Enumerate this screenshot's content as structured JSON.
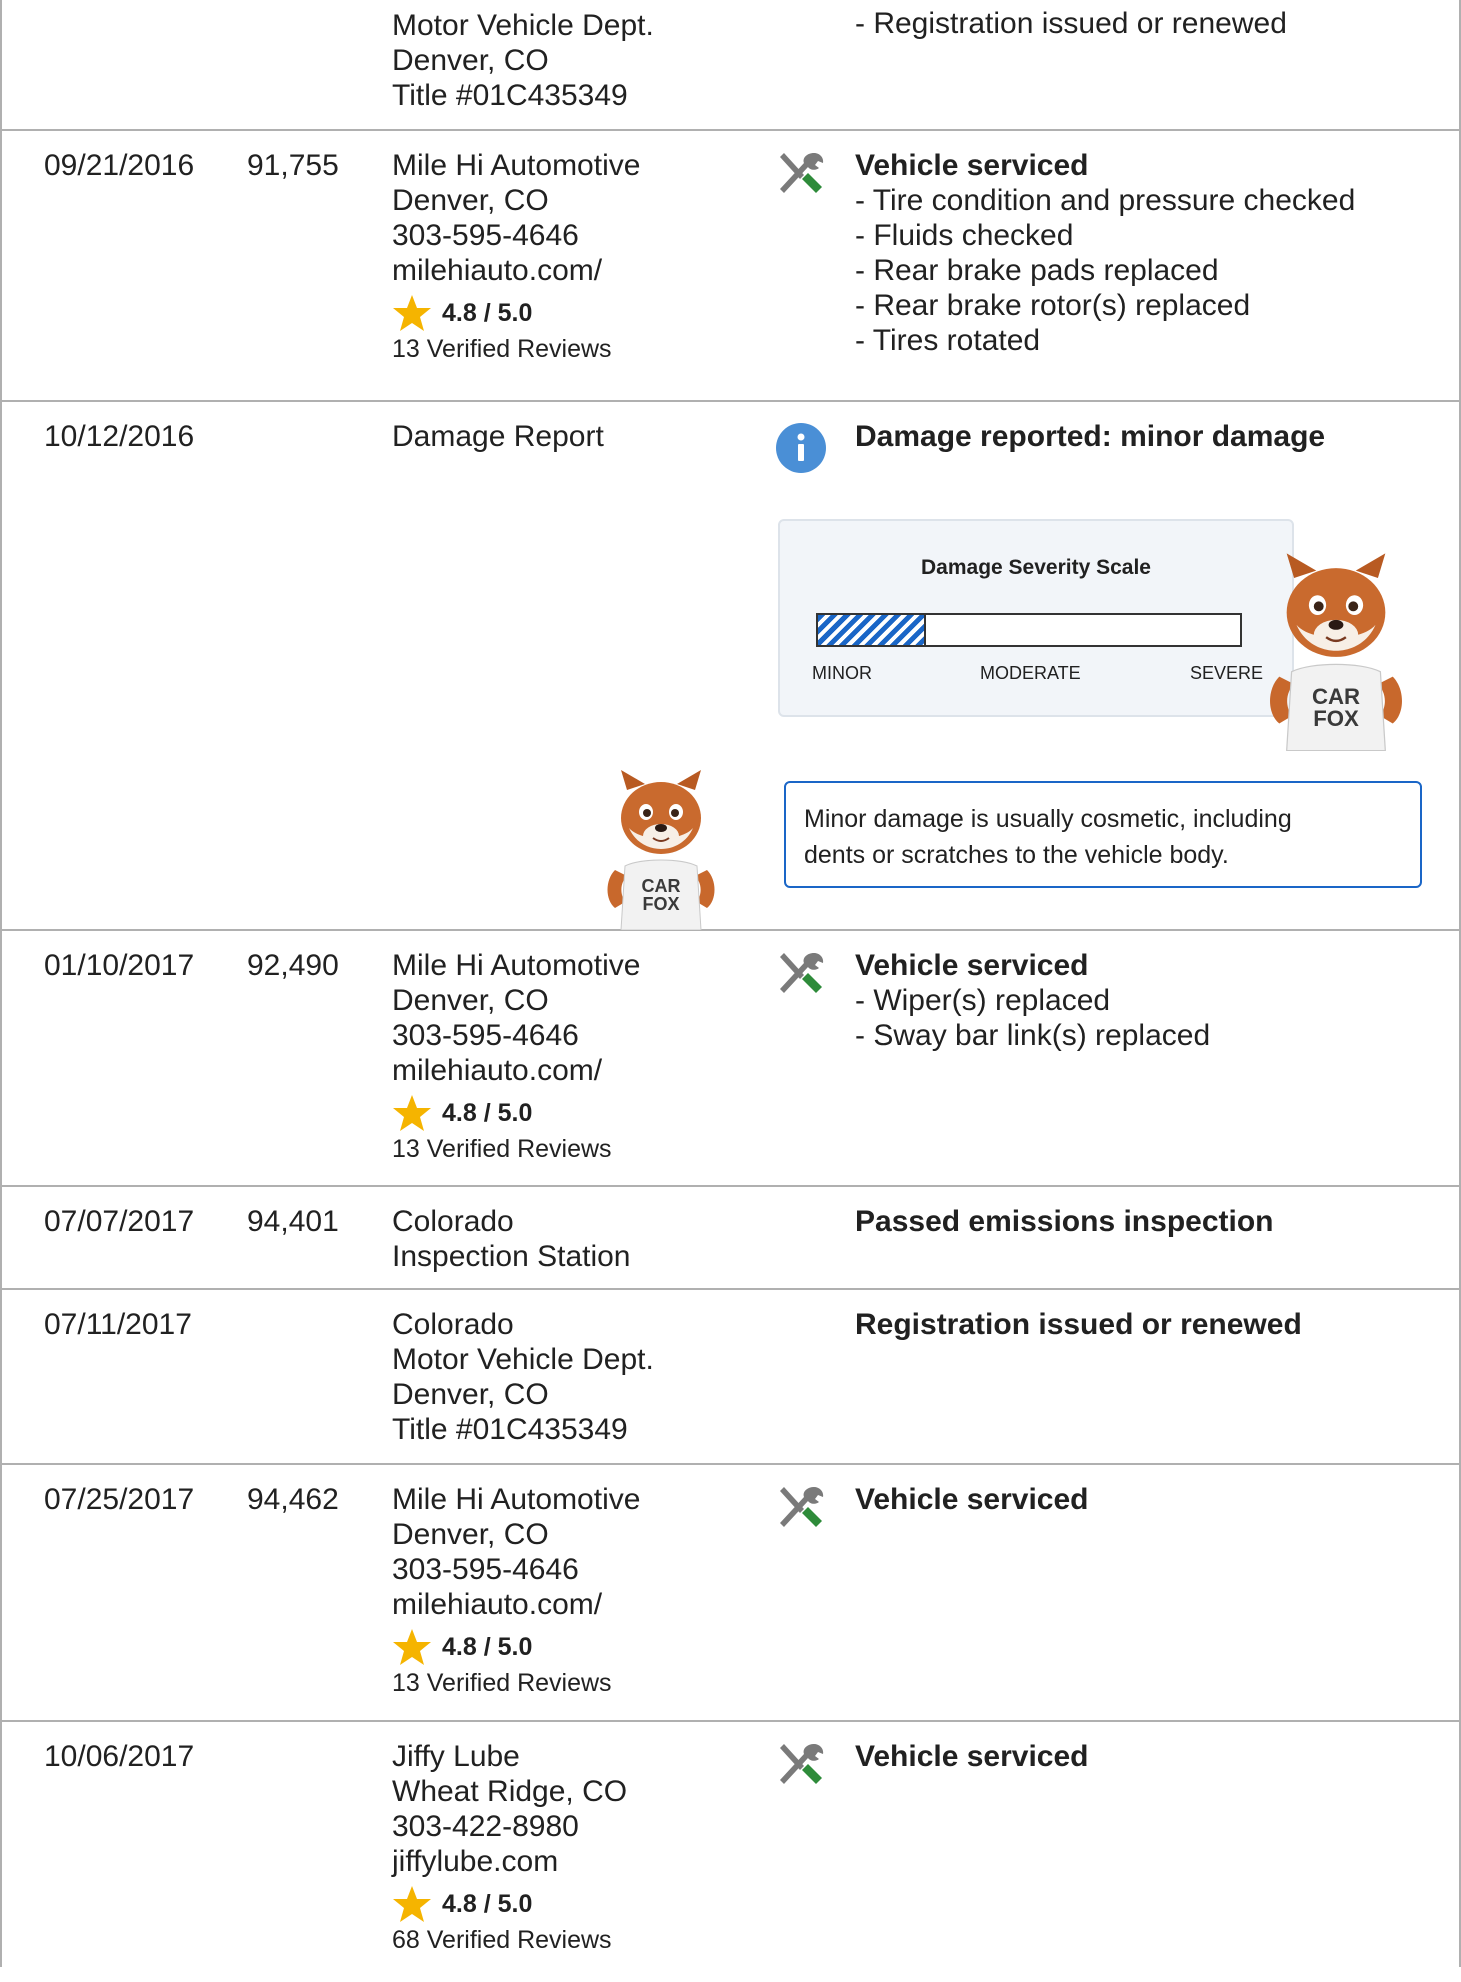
{
  "rows": [
    {
      "date": "",
      "odometer": "",
      "source": [
        "Motor Vehicle Dept.",
        "Denver, CO",
        "Title #01C435349"
      ],
      "details_title": "",
      "details_bullets": [
        "Registration issued or renewed"
      ]
    },
    {
      "date": "09/21/2016",
      "odometer": "91,755",
      "source": [
        "Mile Hi Automotive",
        "Denver, CO",
        "303-595-4646",
        "milehiauto.com/"
      ],
      "rating": "4.8 / 5.0",
      "reviews": "13 Verified Reviews",
      "icon": "wrench-screwdriver-icon",
      "details_title": "Vehicle serviced",
      "details_bullets": [
        "Tire condition and pressure checked",
        "Fluids checked",
        "Rear brake pads replaced",
        "Rear brake rotor(s) replaced",
        "Tires rotated"
      ]
    },
    {
      "date": "10/12/2016",
      "odometer": "",
      "source": [
        "Damage Report"
      ],
      "icon": "info-icon",
      "details_title": "Damage reported: minor damage",
      "severity": {
        "title": "Damage Severity Scale",
        "level": 0.25,
        "labels": [
          "MINOR",
          "MODERATE",
          "SEVERE"
        ]
      },
      "callout": [
        "Minor damage is usually cosmetic, including",
        "dents or scratches to the vehicle body."
      ],
      "mascot_text": [
        "CAR",
        "FOX"
      ]
    },
    {
      "date": "01/10/2017",
      "odometer": "92,490",
      "source": [
        "Mile Hi Automotive",
        "Denver, CO",
        "303-595-4646",
        "milehiauto.com/"
      ],
      "rating": "4.8 / 5.0",
      "reviews": "13 Verified Reviews",
      "icon": "wrench-screwdriver-icon",
      "details_title": "Vehicle serviced",
      "details_bullets": [
        "Wiper(s) replaced",
        "Sway bar link(s) replaced"
      ]
    },
    {
      "date": "07/07/2017",
      "odometer": "94,401",
      "source": [
        "Colorado",
        "Inspection Station"
      ],
      "details_title": "Passed emissions inspection"
    },
    {
      "date": "07/11/2017",
      "odometer": "",
      "source": [
        "Colorado",
        "Motor Vehicle Dept.",
        "Denver, CO",
        "Title #01C435349"
      ],
      "details_title": "Registration issued or renewed"
    },
    {
      "date": "07/25/2017",
      "odometer": "94,462",
      "source": [
        "Mile Hi Automotive",
        "Denver, CO",
        "303-595-4646",
        "milehiauto.com/"
      ],
      "rating": "4.8 / 5.0",
      "reviews": "13 Verified Reviews",
      "icon": "wrench-screwdriver-icon",
      "details_title": "Vehicle serviced"
    },
    {
      "date": "10/06/2017",
      "odometer": "",
      "source": [
        "Jiffy Lube",
        "Wheat Ridge, CO",
        "303-422-8980",
        "jiffylube.com"
      ],
      "rating": "4.8 / 5.0",
      "reviews": "68 Verified Reviews",
      "icon": "wrench-screwdriver-icon",
      "details_title": "Vehicle serviced"
    }
  ],
  "colors": {
    "border": "#b0b0b0",
    "accent_blue": "#1a66c7",
    "info_blue": "#4a8fd6",
    "star": "#f5b400",
    "tool_green": "#2e8b3a",
    "tool_gray": "#7a7a7a"
  }
}
